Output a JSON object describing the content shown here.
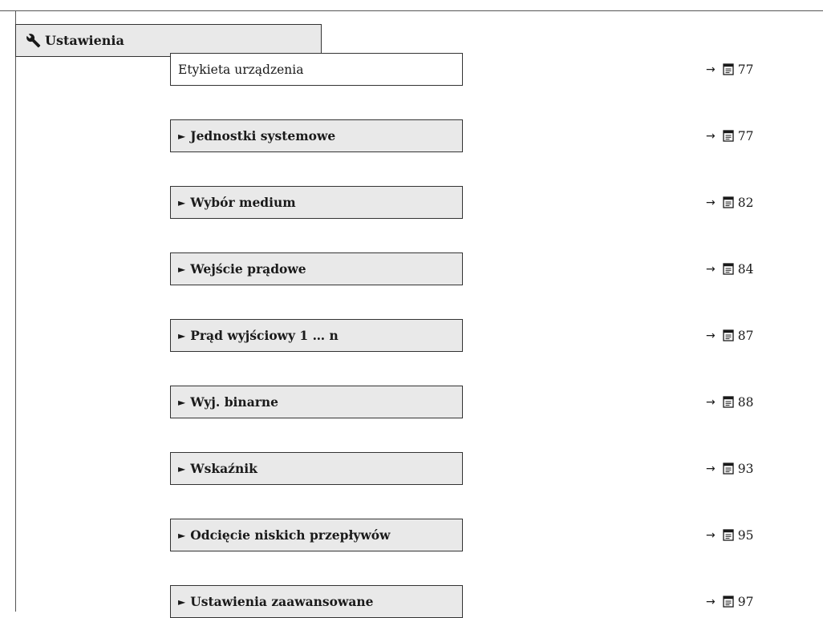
{
  "menu": {
    "title": "Ustawienia",
    "title_icon": "wrench-icon",
    "items": [
      {
        "label": "Etykieta urządzenia",
        "type": "parameter",
        "page": "77"
      },
      {
        "label": "Jednostki systemowe",
        "type": "submenu",
        "marker": "►",
        "page": "77"
      },
      {
        "label": "Wybór medium",
        "type": "submenu",
        "marker": "►",
        "page": "82"
      },
      {
        "label": "Wejście prądowe",
        "type": "submenu",
        "marker": "►",
        "page": "84"
      },
      {
        "label": "Prąd wyjściowy 1 … n",
        "type": "submenu",
        "marker": "►",
        "page": "87"
      },
      {
        "label": "Wyj. binarne",
        "type": "submenu",
        "marker": "►",
        "page": "88"
      },
      {
        "label": "Wskaźnik",
        "type": "submenu",
        "marker": "►",
        "page": "93"
      },
      {
        "label": "Odcięcie niskich przepływów",
        "type": "submenu",
        "marker": "►",
        "page": "95"
      },
      {
        "label": "Ustawienia zaawansowane",
        "type": "submenu",
        "marker": "►",
        "page": "97"
      }
    ]
  },
  "ref_arrow": "→",
  "ref_icon": "book-icon"
}
